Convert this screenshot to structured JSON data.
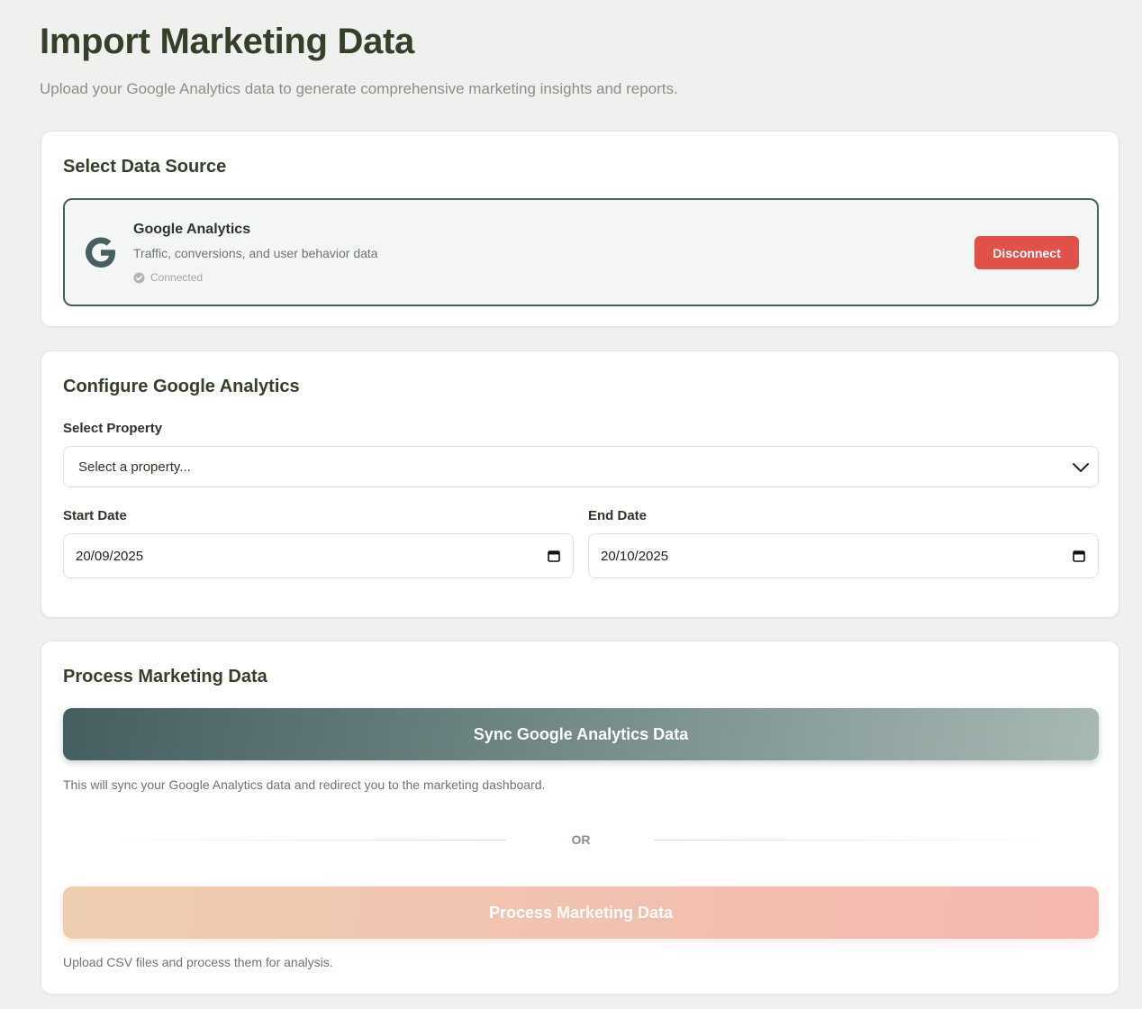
{
  "header": {
    "title": "Import Marketing Data",
    "subtitle": "Upload your Google Analytics data to generate comprehensive marketing insights and reports."
  },
  "source_section": {
    "title": "Select Data Source",
    "source": {
      "icon": "google-g-icon",
      "name": "Google Analytics",
      "description": "Traffic, conversions, and user behavior data",
      "status": "Connected",
      "disconnect_label": "Disconnect"
    }
  },
  "config_section": {
    "title": "Configure Google Analytics",
    "property_label": "Select Property",
    "property_value": "Select a property...",
    "start_label": "Start Date",
    "start_value": "20/09/2025",
    "end_label": "End Date",
    "end_value": "20/10/2025"
  },
  "process_section": {
    "title": "Process Marketing Data",
    "sync_label": "Sync Google Analytics Data",
    "sync_help": "This will sync your Google Analytics data and redirect you to the marketing dashboard.",
    "or_label": "OR",
    "process_label": "Process Marketing Data",
    "process_help": "Upload CSV files and process them for analysis."
  },
  "colors": {
    "accent_dark": "#485f60",
    "danger": "#e05149",
    "heading": "#34402a"
  }
}
